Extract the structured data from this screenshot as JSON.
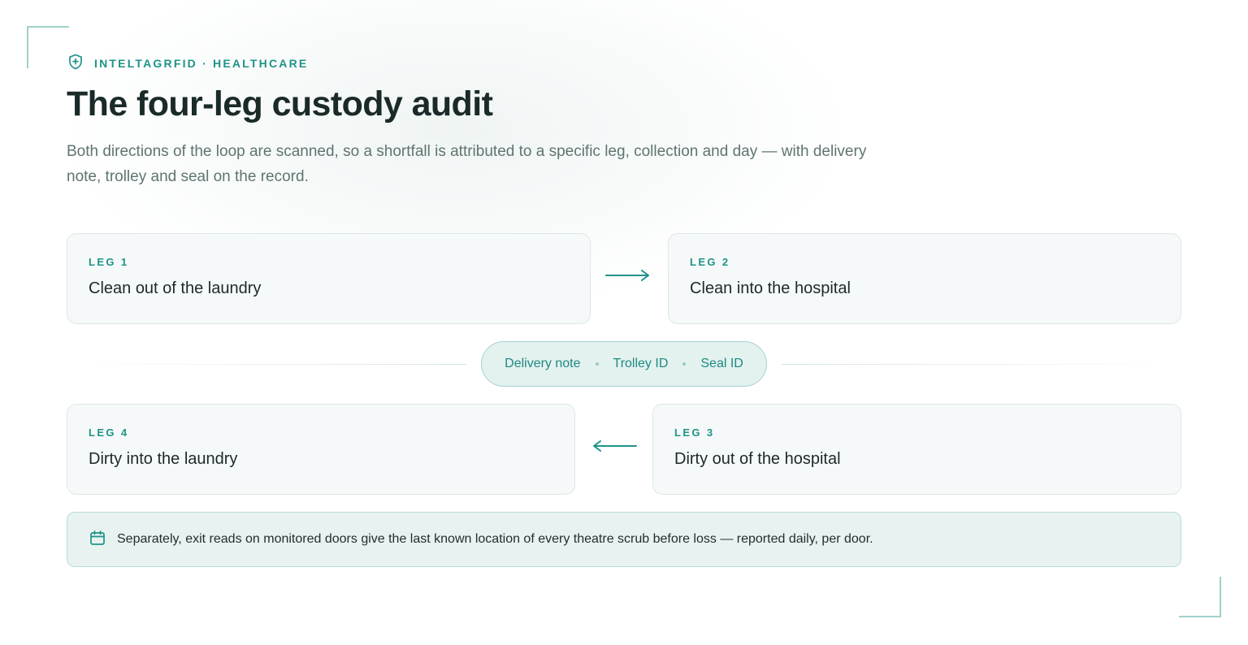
{
  "eyebrow": {
    "text": "INTELTAGRFID · HEALTHCARE",
    "icon": "shield-plus-icon"
  },
  "title": "The four-leg custody audit",
  "subtitle": "Both directions of the loop are scanned, so a shortfall is attributed to a specific leg, collection and day — with delivery note, trolley and seal on the record.",
  "legs": [
    {
      "label": "LEG 1",
      "title": "Clean out of the laundry"
    },
    {
      "label": "LEG 2",
      "title": "Clean into the hospital"
    },
    {
      "label": "LEG 3",
      "title": "Dirty out of the hospital"
    },
    {
      "label": "LEG 4",
      "title": "Dirty into the laundry"
    }
  ],
  "record": {
    "items": [
      "Delivery note",
      "Trolley ID",
      "Seal ID"
    ]
  },
  "note": {
    "icon": "calendar-icon",
    "text": "Separately, exit reads on monitored doors give the last known location of every theatre scrub before loss — reported daily, per door."
  },
  "colors": {
    "accent": "#1f9288",
    "card_bg": "#f6f9f9",
    "card_border": "#dde8e6",
    "pill_bg": "#e3f1ef",
    "note_bg": "#e8f3f1"
  }
}
